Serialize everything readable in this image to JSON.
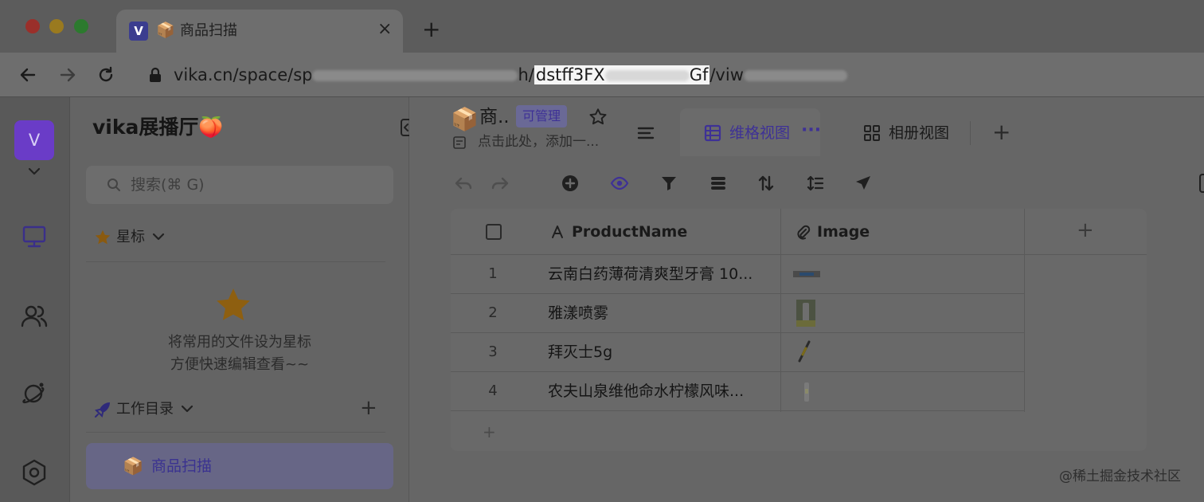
{
  "browser": {
    "tab_title": "商品扫描",
    "tab_emoji": "📦",
    "favicon_letter": "V",
    "new_tab_label": "+",
    "close_label": "×",
    "url_prefix": "vika.cn/space/sp",
    "url_mid": "h/",
    "url_highlight_start": "dstff3FX",
    "url_highlight_end": "Gf",
    "url_suffix": "/viw",
    "traffic_colors": [
      "#9a2f2a",
      "#9a7a1f",
      "#2c7a2e"
    ]
  },
  "rail": {
    "avatar_letter": "V",
    "accent": "#6a3cc7"
  },
  "sidebar": {
    "space_name": "vika展播厅🍑",
    "search_placeholder": "搜索(⌘ G)",
    "starred_label": "星标",
    "empty_line1": "将常用的文件设为星标",
    "empty_line2": "方便快速编辑查看~~",
    "workspace_label": "工作目录",
    "add_label": "+",
    "files": [
      {
        "emoji": "📦",
        "label": "商品扫描"
      }
    ]
  },
  "main": {
    "sheet_emoji": "📦",
    "sheet_title": "商..",
    "permission_badge": "可管理",
    "description": "点击此处，添加一...",
    "views": [
      {
        "label": "维格视图",
        "more": "···",
        "active": true
      },
      {
        "label": "相册视图",
        "active": false
      }
    ],
    "add_view_label": "+",
    "grid": {
      "columns": [
        {
          "label": "ProductName",
          "type_icon": "text-field-icon"
        },
        {
          "label": "Image",
          "type_icon": "attachment-icon"
        }
      ],
      "add_column_label": "+",
      "rows": [
        {
          "index": "1",
          "name": "云南白药薄荷清爽型牙膏 10..."
        },
        {
          "index": "2",
          "name": "雅漾喷雾"
        },
        {
          "index": "3",
          "name": "拜灭士5g"
        },
        {
          "index": "4",
          "name": "农夫山泉维他命水柠檬风味..."
        }
      ],
      "add_row_label": "+"
    }
  },
  "watermark": "@稀土掘金技术社区"
}
